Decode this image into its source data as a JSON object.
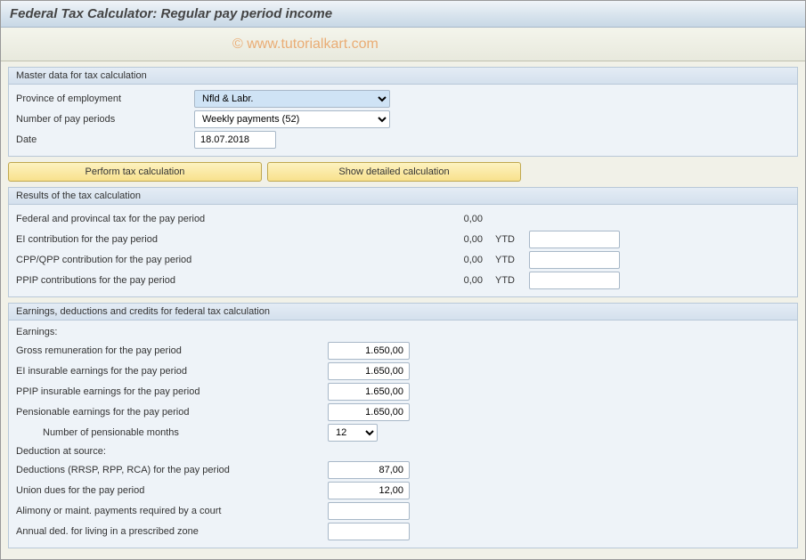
{
  "title": "Federal Tax Calculator: Regular pay period income",
  "watermark": "© www.tutorialkart.com",
  "master": {
    "header": "Master data for tax calculation",
    "province_label": "Province of employment",
    "province_value": "Nfld & Labr.",
    "periods_label": "Number of pay periods",
    "periods_value": "Weekly payments (52)",
    "date_label": "Date",
    "date_value": "18.07.2018"
  },
  "buttons": {
    "perform": "Perform tax calculation",
    "detailed": "Show detailed calculation"
  },
  "results": {
    "header": "Results of the tax calculation",
    "rows": [
      {
        "label": "Federal and provincal tax for the pay period",
        "value": "0,00",
        "ytd": false
      },
      {
        "label": "EI contribution for the pay period",
        "value": "0,00",
        "ytd": true,
        "ytd_value": ""
      },
      {
        "label": "CPP/QPP contribution for the pay period",
        "value": "0,00",
        "ytd": true,
        "ytd_value": ""
      },
      {
        "label": "PPIP contributions for the pay period",
        "value": "0,00",
        "ytd": true,
        "ytd_value": ""
      }
    ],
    "ytd_label": "YTD"
  },
  "earnings": {
    "header": "Earnings, deductions and credits for federal tax calculation",
    "earnings_label": "Earnings:",
    "rows_earn": [
      {
        "label": "Gross remuneration for the pay period",
        "value": "1.650,00"
      },
      {
        "label": "EI insurable earnings for the pay period",
        "value": "1.650,00"
      },
      {
        "label": "PPIP insurable earnings for the pay period",
        "value": "1.650,00"
      },
      {
        "label": "Pensionable earnings for the pay period",
        "value": "1.650,00"
      }
    ],
    "months_label": "Number of pensionable months",
    "months_value": "12",
    "deduction_label": "Deduction at source:",
    "rows_ded": [
      {
        "label": "Deductions (RRSP, RPP, RCA) for the pay period",
        "value": "87,00"
      },
      {
        "label": "Union dues for the pay period",
        "value": "12,00"
      },
      {
        "label": "Alimony or maint. payments required by a court",
        "value": ""
      },
      {
        "label": "Annual ded. for living in a prescribed zone",
        "value": ""
      }
    ]
  }
}
